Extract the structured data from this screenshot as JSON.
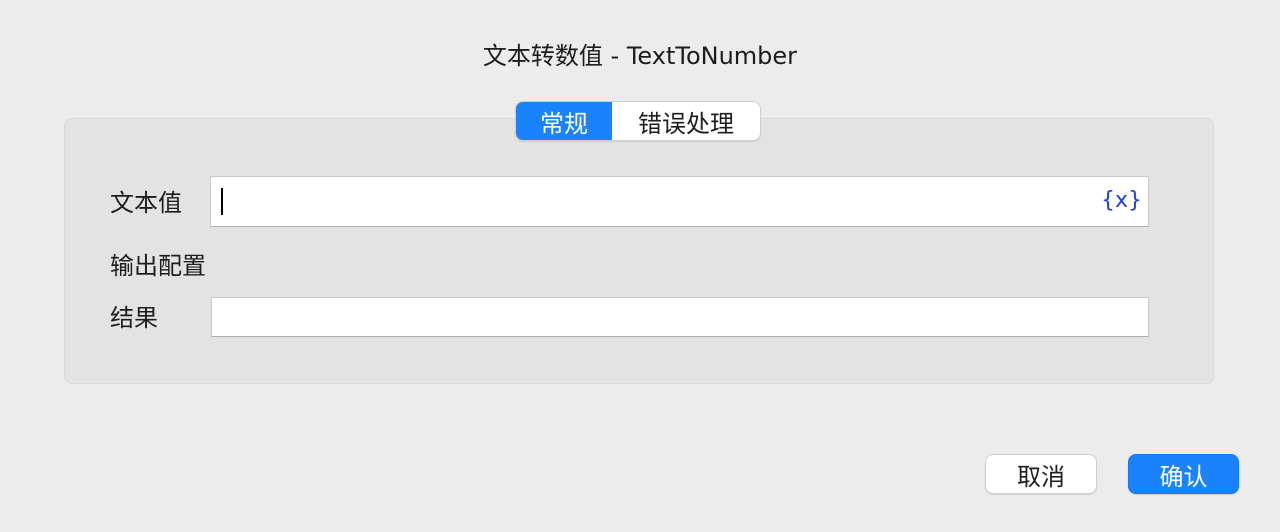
{
  "dialog": {
    "title": "文本转数值 - TextToNumber"
  },
  "tabs": [
    {
      "label": "常规",
      "active": true
    },
    {
      "label": "错误处理",
      "active": false
    }
  ],
  "form": {
    "text_value_label": "文本值",
    "text_value": "",
    "variable_button_label": "{x}",
    "output_section_label": "输出配置",
    "result_label": "结果",
    "result_value": ""
  },
  "buttons": {
    "cancel_label": "取消",
    "confirm_label": "确认"
  },
  "colors": {
    "accent": "#1a82fb",
    "background": "#ececec",
    "panel": "#e3e3e3",
    "variable_icon": "#1f3fd6"
  }
}
